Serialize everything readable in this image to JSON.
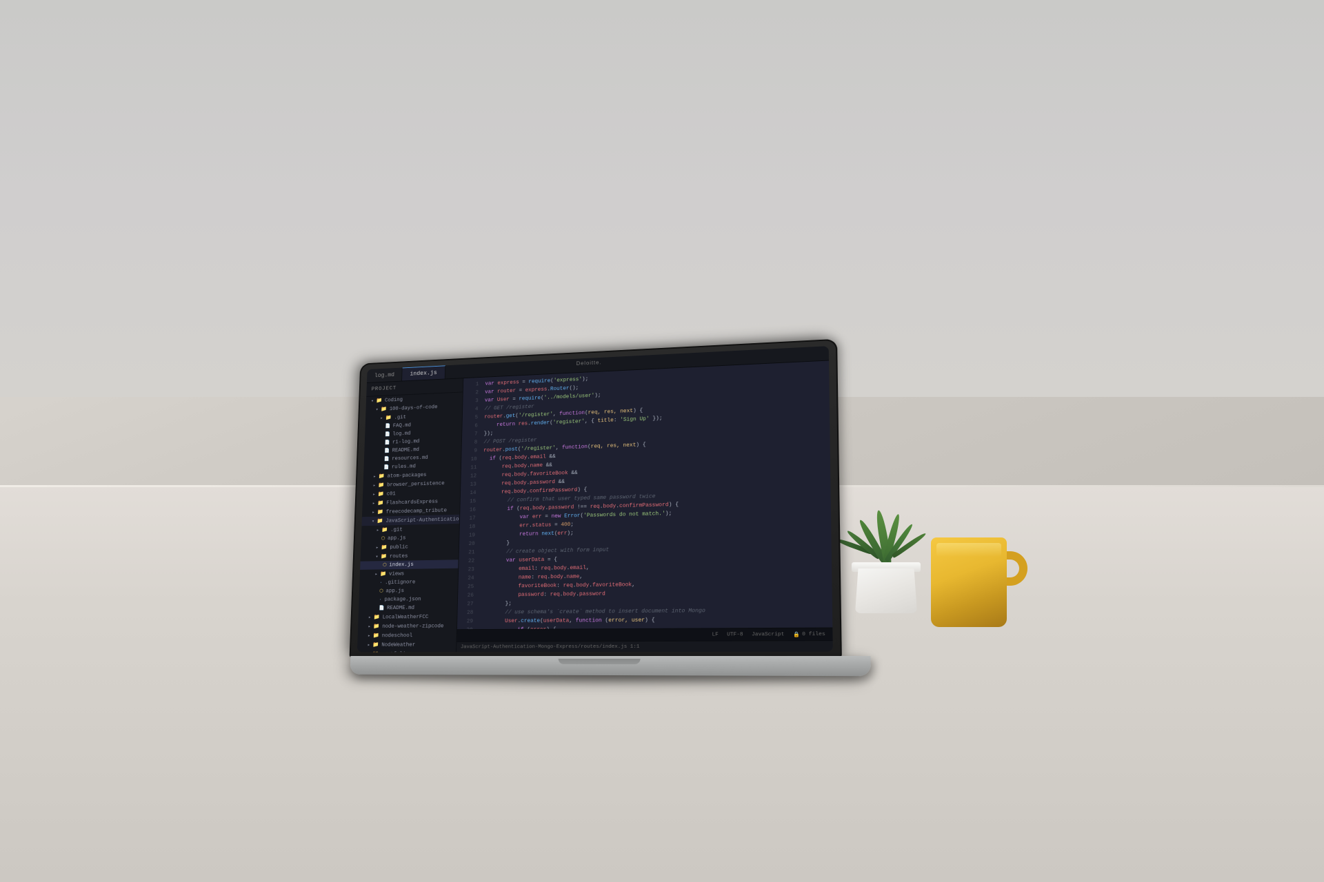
{
  "scene": {
    "description": "Laptop on desk with code editor open, plant and yellow mug in background"
  },
  "laptop": {
    "brand": "Deloitte.",
    "screen": {
      "editor": "VS Code style dark theme",
      "tabs": [
        {
          "label": "log.md",
          "active": false
        },
        {
          "label": "index.js",
          "active": true
        }
      ]
    }
  },
  "ide": {
    "sidebar_title": "Project",
    "sidebar_items": [
      {
        "label": "Coding",
        "type": "folder",
        "open": true,
        "indent": 0
      },
      {
        "label": "100-days-of-code",
        "type": "folder",
        "open": true,
        "indent": 1
      },
      {
        "label": ".git",
        "type": "folder",
        "indent": 2
      },
      {
        "label": "FAQ.md",
        "type": "file",
        "indent": 2
      },
      {
        "label": "log.md",
        "type": "file",
        "indent": 2
      },
      {
        "label": "r1-log.md",
        "type": "file",
        "indent": 2
      },
      {
        "label": "README.md",
        "type": "file",
        "indent": 2
      },
      {
        "label": "resources.md",
        "type": "file",
        "indent": 2
      },
      {
        "label": "rules.md",
        "type": "file",
        "indent": 2
      },
      {
        "label": "atom-packages",
        "type": "folder",
        "indent": 1
      },
      {
        "label": "browser_persistence",
        "type": "folder",
        "indent": 1
      },
      {
        "label": "c01",
        "type": "folder",
        "indent": 1
      },
      {
        "label": "FlashcardsExpress",
        "type": "folder",
        "indent": 1
      },
      {
        "label": "freecodecamp_tribute",
        "type": "folder",
        "indent": 1
      },
      {
        "label": "JavaScript-Authentication",
        "type": "folder",
        "open": true,
        "indent": 1
      },
      {
        "label": ".git",
        "type": "folder",
        "indent": 2
      },
      {
        "label": "app.js",
        "type": "file",
        "indent": 2
      },
      {
        "label": "public",
        "type": "folder",
        "indent": 2
      },
      {
        "label": "routes",
        "type": "folder",
        "open": true,
        "indent": 2
      },
      {
        "label": "index.js",
        "type": "file-active",
        "indent": 3
      },
      {
        "label": "views",
        "type": "folder",
        "indent": 2
      },
      {
        "label": ".gitignore",
        "type": "file",
        "indent": 2
      },
      {
        "label": "app.js",
        "type": "file",
        "indent": 2
      },
      {
        "label": "package.json",
        "type": "file",
        "indent": 2
      },
      {
        "label": "README.md",
        "type": "file",
        "indent": 2
      },
      {
        "label": "LocalWeatherFCC",
        "type": "folder",
        "indent": 1
      },
      {
        "label": "node-weather-zipcode",
        "type": "folder",
        "indent": 1
      },
      {
        "label": "nodeschool",
        "type": "folder",
        "indent": 1
      },
      {
        "label": "NodeWeather",
        "type": "folder",
        "indent": 1
      },
      {
        "label": "portfolio",
        "type": "folder",
        "indent": 1
      }
    ],
    "status_bar": {
      "line_ending": "LF",
      "encoding": "UTF-8",
      "language": "JavaScript",
      "files": "0 files"
    },
    "path_bar": "JavaScript-Authentication-Mongo-Express/routes/index.js  1:1"
  }
}
